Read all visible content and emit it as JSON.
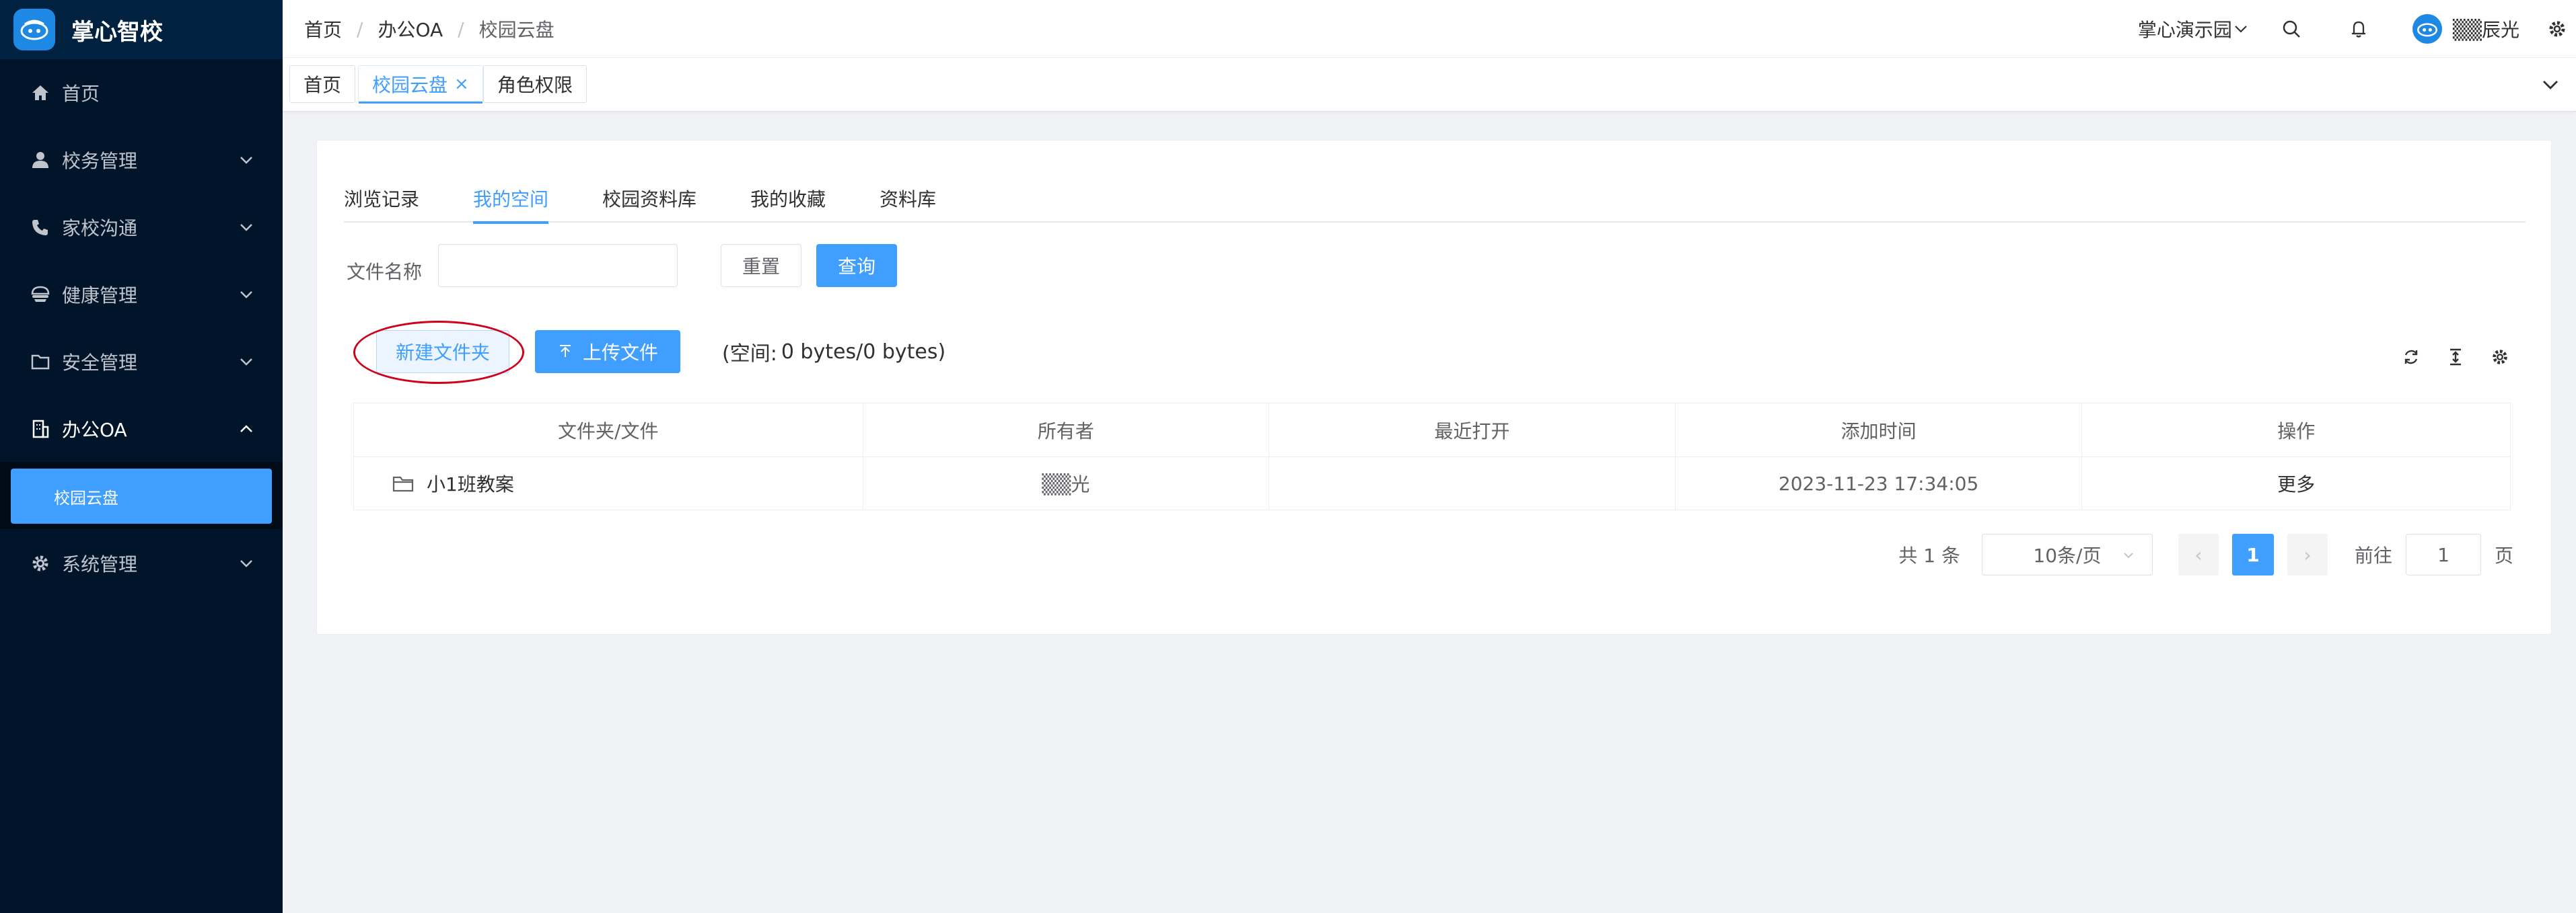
{
  "app": {
    "name": "掌心智校"
  },
  "sidebar": {
    "items": [
      {
        "label": "首页",
        "icon": "home-icon"
      },
      {
        "label": "校务管理",
        "icon": "user-icon"
      },
      {
        "label": "家校沟通",
        "icon": "phone-icon"
      },
      {
        "label": "健康管理",
        "icon": "health-icon"
      },
      {
        "label": "安全管理",
        "icon": "folder-icon"
      },
      {
        "label": "办公OA",
        "icon": "building-icon"
      },
      {
        "label": "系统管理",
        "icon": "gear-icon"
      }
    ],
    "submenu": {
      "label": "校园云盘"
    }
  },
  "header": {
    "breadcrumb": [
      "首页",
      "办公OA",
      "校园云盘"
    ],
    "separator": "/",
    "school": "掌心演示园",
    "username": "▒▒辰光"
  },
  "tags": [
    {
      "label": "首页"
    },
    {
      "label": "校园云盘",
      "close": "×"
    },
    {
      "label": "角色权限"
    }
  ],
  "subtabs": [
    "浏览记录",
    "我的空间",
    "校园资料库",
    "我的收藏",
    "资料库"
  ],
  "filter": {
    "label": "文件名称",
    "value": "",
    "placeholder": "",
    "reset": "重置",
    "query": "查询"
  },
  "actions": {
    "new_folder": "新建文件夹",
    "upload": "上传文件",
    "space_label": "(空间:",
    "space_value": "0 bytes/0 bytes)"
  },
  "table": {
    "columns": [
      "文件夹/文件",
      "所有者",
      "最近打开",
      "添加时间",
      "操作"
    ],
    "rows": [
      {
        "name": "小1班教案",
        "owner": "▒▒光",
        "opened": "",
        "added": "2023-11-23 17:34:05",
        "action": "更多"
      }
    ]
  },
  "pagination": {
    "total": "共 1 条",
    "page_size": "10条/页",
    "prev": "‹",
    "current": "1",
    "next": "›",
    "goto_label": "前往",
    "goto_value": "1",
    "page_unit": "页"
  },
  "colors": {
    "primary": "#409eff",
    "sidebar": "#001529",
    "annotation": "#d0021b"
  }
}
